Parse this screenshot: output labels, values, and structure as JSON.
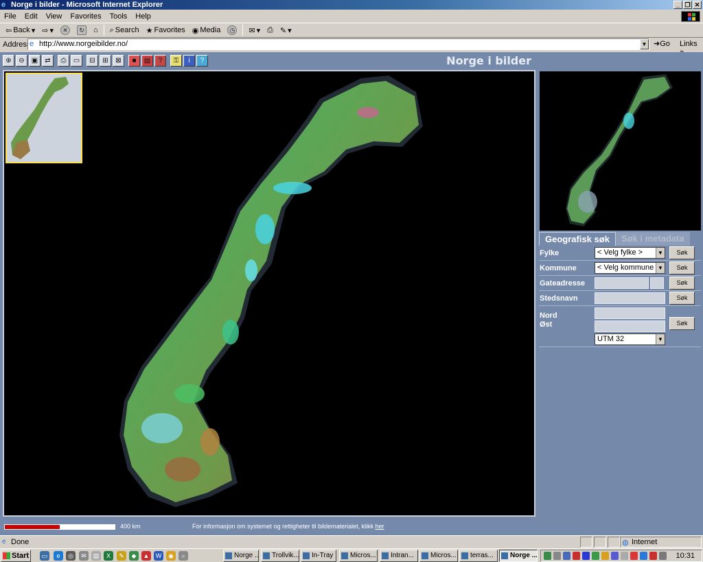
{
  "window": {
    "title": "Norge i bilder - Microsoft Internet Explorer",
    "controls": [
      "_",
      "❐",
      "✕"
    ]
  },
  "menu": [
    "File",
    "Edit",
    "View",
    "Favorites",
    "Tools",
    "Help"
  ],
  "toolbar": {
    "back": "Back",
    "search": "Search",
    "favorites": "Favorites",
    "media": "Media"
  },
  "address": {
    "label": "Address",
    "url": "http://www.norgeibilder.no/",
    "go": "Go",
    "links": "Links"
  },
  "app": {
    "title": "Norge i bilder",
    "map_tools": [
      "zoom-in",
      "zoom-out",
      "zoom-box",
      "refresh",
      "print",
      "layer",
      "measure",
      "map",
      "export",
      "layer-red",
      "layer-red-2",
      "layer-red-3",
      "lock",
      "info",
      "help"
    ],
    "scale_label": "400 km",
    "info_text": "For informasjon om systemet og rettigheter til bildematerialet, klikk",
    "info_link": "her",
    "tabs": {
      "active": "Geografisk søk",
      "inactive": "Søk i metadata"
    },
    "form": {
      "fylke_label": "Fylke",
      "fylke_value": "< Velg fylke >",
      "kommune_label": "Kommune",
      "kommune_value": "< Velg kommune >",
      "gate_label": "Gateadresse",
      "sted_label": "Stedsnavn",
      "nord_label": "Nord",
      "ost_label": "Øst",
      "utm_value": "UTM 32",
      "search_button": "Søk"
    }
  },
  "status": {
    "text": "Done",
    "zone": "Internet"
  },
  "taskbar": {
    "start": "Start",
    "tasks": [
      "Norge ...",
      "Trollvik...",
      "In-Tray",
      "Micros...",
      "Intran...",
      "Micros...",
      "terras...",
      "Norge ..."
    ],
    "clock": "10:31"
  }
}
